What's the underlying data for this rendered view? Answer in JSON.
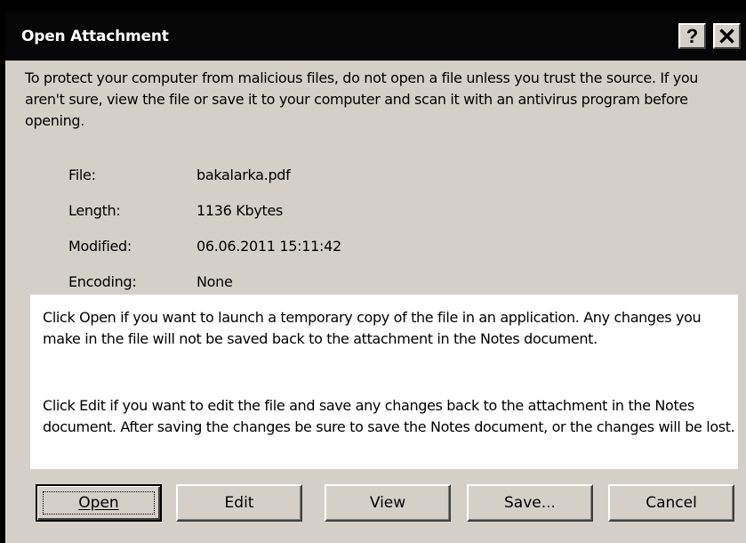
{
  "window": {
    "title": "Open Attachment",
    "help_label": "?",
    "close_label": "✕"
  },
  "intro_text": "To protect your computer from malicious files, do not open a file unless you trust the source. If you aren't sure, view the file or save it to your computer and scan it with an antivirus program before opening.",
  "details": [
    {
      "label": "File:",
      "value": "bakalarka.pdf"
    },
    {
      "label": "Length:",
      "value": "1136 Kbytes"
    },
    {
      "label": "Modified:",
      "value": "06.06.2011 15:11:42"
    },
    {
      "label": "Encoding:",
      "value": "None"
    }
  ],
  "info": {
    "open_text": "Click Open if you want to launch a temporary copy of the file in an application. Any changes you make in the file will not be saved back to the attachment in the Notes document.",
    "edit_text": "Click Edit if you want to edit the file and save any changes back to the attachment in the Notes document. After saving the changes be sure to save the Notes document, or the changes will be lost."
  },
  "buttons": {
    "open": "Open",
    "edit": "Edit",
    "view": "View",
    "save": "Save...",
    "cancel": "Cancel"
  }
}
